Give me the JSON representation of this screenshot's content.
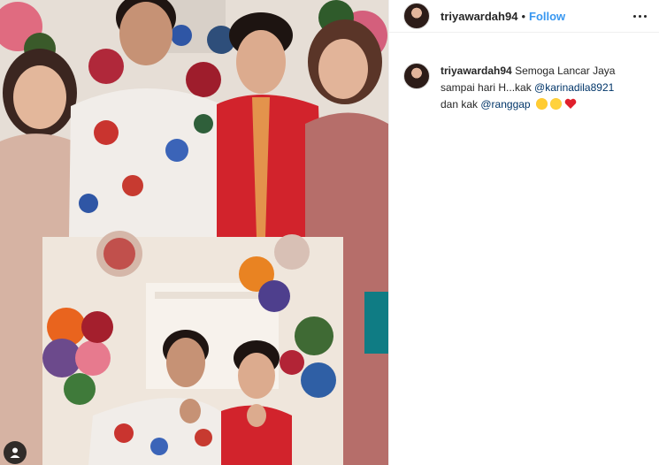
{
  "post": {
    "username": "triyawardah94",
    "follow_label": "Follow",
    "separator": "•"
  },
  "caption": {
    "username": "triyawardah94",
    "text_1": "Semoga Lancar Jaya sampai hari H...kak",
    "mention_1": "@karinadila8921",
    "text_2": "dan kak",
    "mention_2": "@ranggap",
    "emojis": [
      "heart-eyes-emoji",
      "kissing-emoji",
      "red-heart-emoji"
    ]
  },
  "colors": {
    "follow_blue": "#3897f0",
    "mention_navy": "#003569",
    "text": "#262626",
    "border": "#efefef"
  },
  "icons": {
    "more": "more-options-icon",
    "user_tag": "user-tag-icon"
  }
}
